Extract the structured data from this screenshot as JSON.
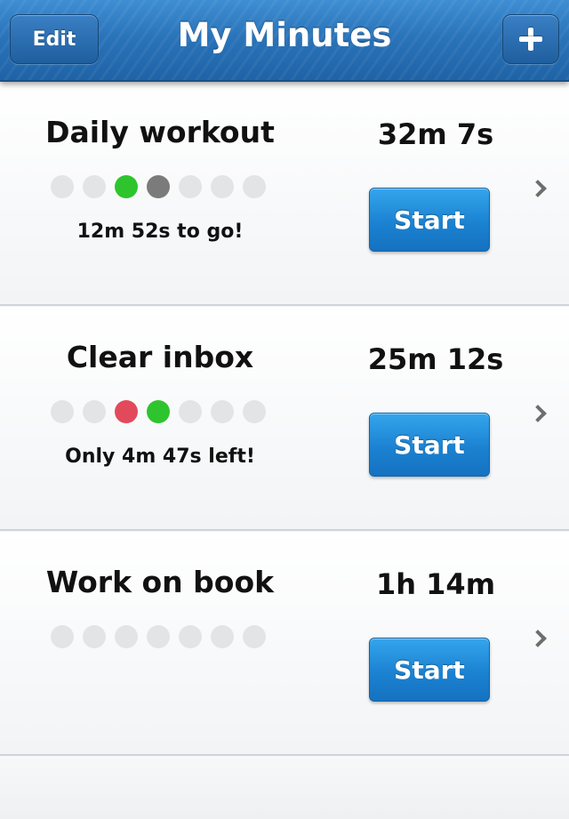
{
  "navbar": {
    "title": "My Minutes",
    "edit_label": "Edit",
    "add_icon": "plus-icon"
  },
  "rows": [
    {
      "title": "Daily workout",
      "duration": "32m 7s",
      "status": "12m 52s to go!",
      "dots": [
        "empty",
        "empty",
        "green",
        "gray",
        "empty",
        "empty",
        "empty"
      ],
      "start_label": "Start"
    },
    {
      "title": "Clear inbox",
      "duration": "25m 12s",
      "status": "Only  4m 47s left!",
      "dots": [
        "empty",
        "empty",
        "red",
        "green",
        "empty",
        "empty",
        "empty"
      ],
      "start_label": "Start"
    },
    {
      "title": "Work on book",
      "duration": "1h 14m",
      "status": "",
      "dots": [
        "empty",
        "empty",
        "empty",
        "empty",
        "empty",
        "empty",
        "empty"
      ],
      "start_label": "Start"
    }
  ],
  "colors": {
    "accent": "#1b82d2",
    "navbar": "#2a74ba",
    "dot_green": "#2ec42e",
    "dot_gray": "#7b7b7b",
    "dot_red": "#e24a5c",
    "dot_empty": "#e3e4e6"
  }
}
